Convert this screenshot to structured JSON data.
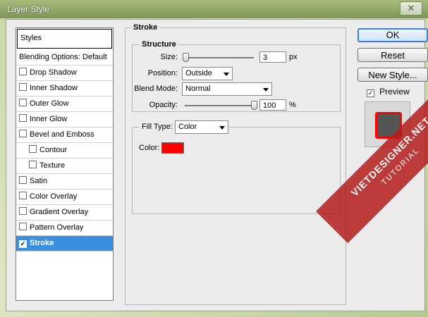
{
  "window": {
    "title": "Layer Style",
    "close_glyph": "✕"
  },
  "styles_list": {
    "header": "Styles",
    "items": [
      {
        "label": "Blending Options: Default",
        "checkbox": false,
        "checked": false
      },
      {
        "label": "Drop Shadow",
        "checkbox": true,
        "checked": false
      },
      {
        "label": "Inner Shadow",
        "checkbox": true,
        "checked": false
      },
      {
        "label": "Outer Glow",
        "checkbox": true,
        "checked": false
      },
      {
        "label": "Inner Glow",
        "checkbox": true,
        "checked": false
      },
      {
        "label": "Bevel and Emboss",
        "checkbox": true,
        "checked": false
      },
      {
        "label": "Contour",
        "checkbox": true,
        "checked": false,
        "indent": true
      },
      {
        "label": "Texture",
        "checkbox": true,
        "checked": false,
        "indent": true
      },
      {
        "label": "Satin",
        "checkbox": true,
        "checked": false
      },
      {
        "label": "Color Overlay",
        "checkbox": true,
        "checked": false
      },
      {
        "label": "Gradient Overlay",
        "checkbox": true,
        "checked": false
      },
      {
        "label": "Pattern Overlay",
        "checkbox": true,
        "checked": false
      },
      {
        "label": "Stroke",
        "checkbox": true,
        "checked": true,
        "selected": true
      }
    ]
  },
  "stroke": {
    "section_title": "Stroke",
    "structure": {
      "title": "Structure",
      "size_label": "Size:",
      "size_value": "3",
      "size_unit": "px",
      "size_fraction": 0.01,
      "position_label": "Position:",
      "position_value": "Outside",
      "blend_label": "Blend Mode:",
      "blend_value": "Normal",
      "opacity_label": "Opacity:",
      "opacity_value": "100",
      "opacity_unit": "%",
      "opacity_fraction": 1.0
    },
    "fill": {
      "type_label": "Fill Type:",
      "type_value": "Color",
      "color_label": "Color:",
      "color_hex": "#ff0000"
    }
  },
  "buttons": {
    "ok": "OK",
    "reset": "Reset",
    "new_style": "New Style...",
    "preview": "Preview",
    "preview_checked": true
  },
  "watermark": {
    "brand": "VIETDESIGNER.NET",
    "sub": "TUTORIAL"
  },
  "colors": {
    "selection": "#3b8fe0",
    "accent": "#3c7fd6",
    "stroke": "#ff0000"
  }
}
